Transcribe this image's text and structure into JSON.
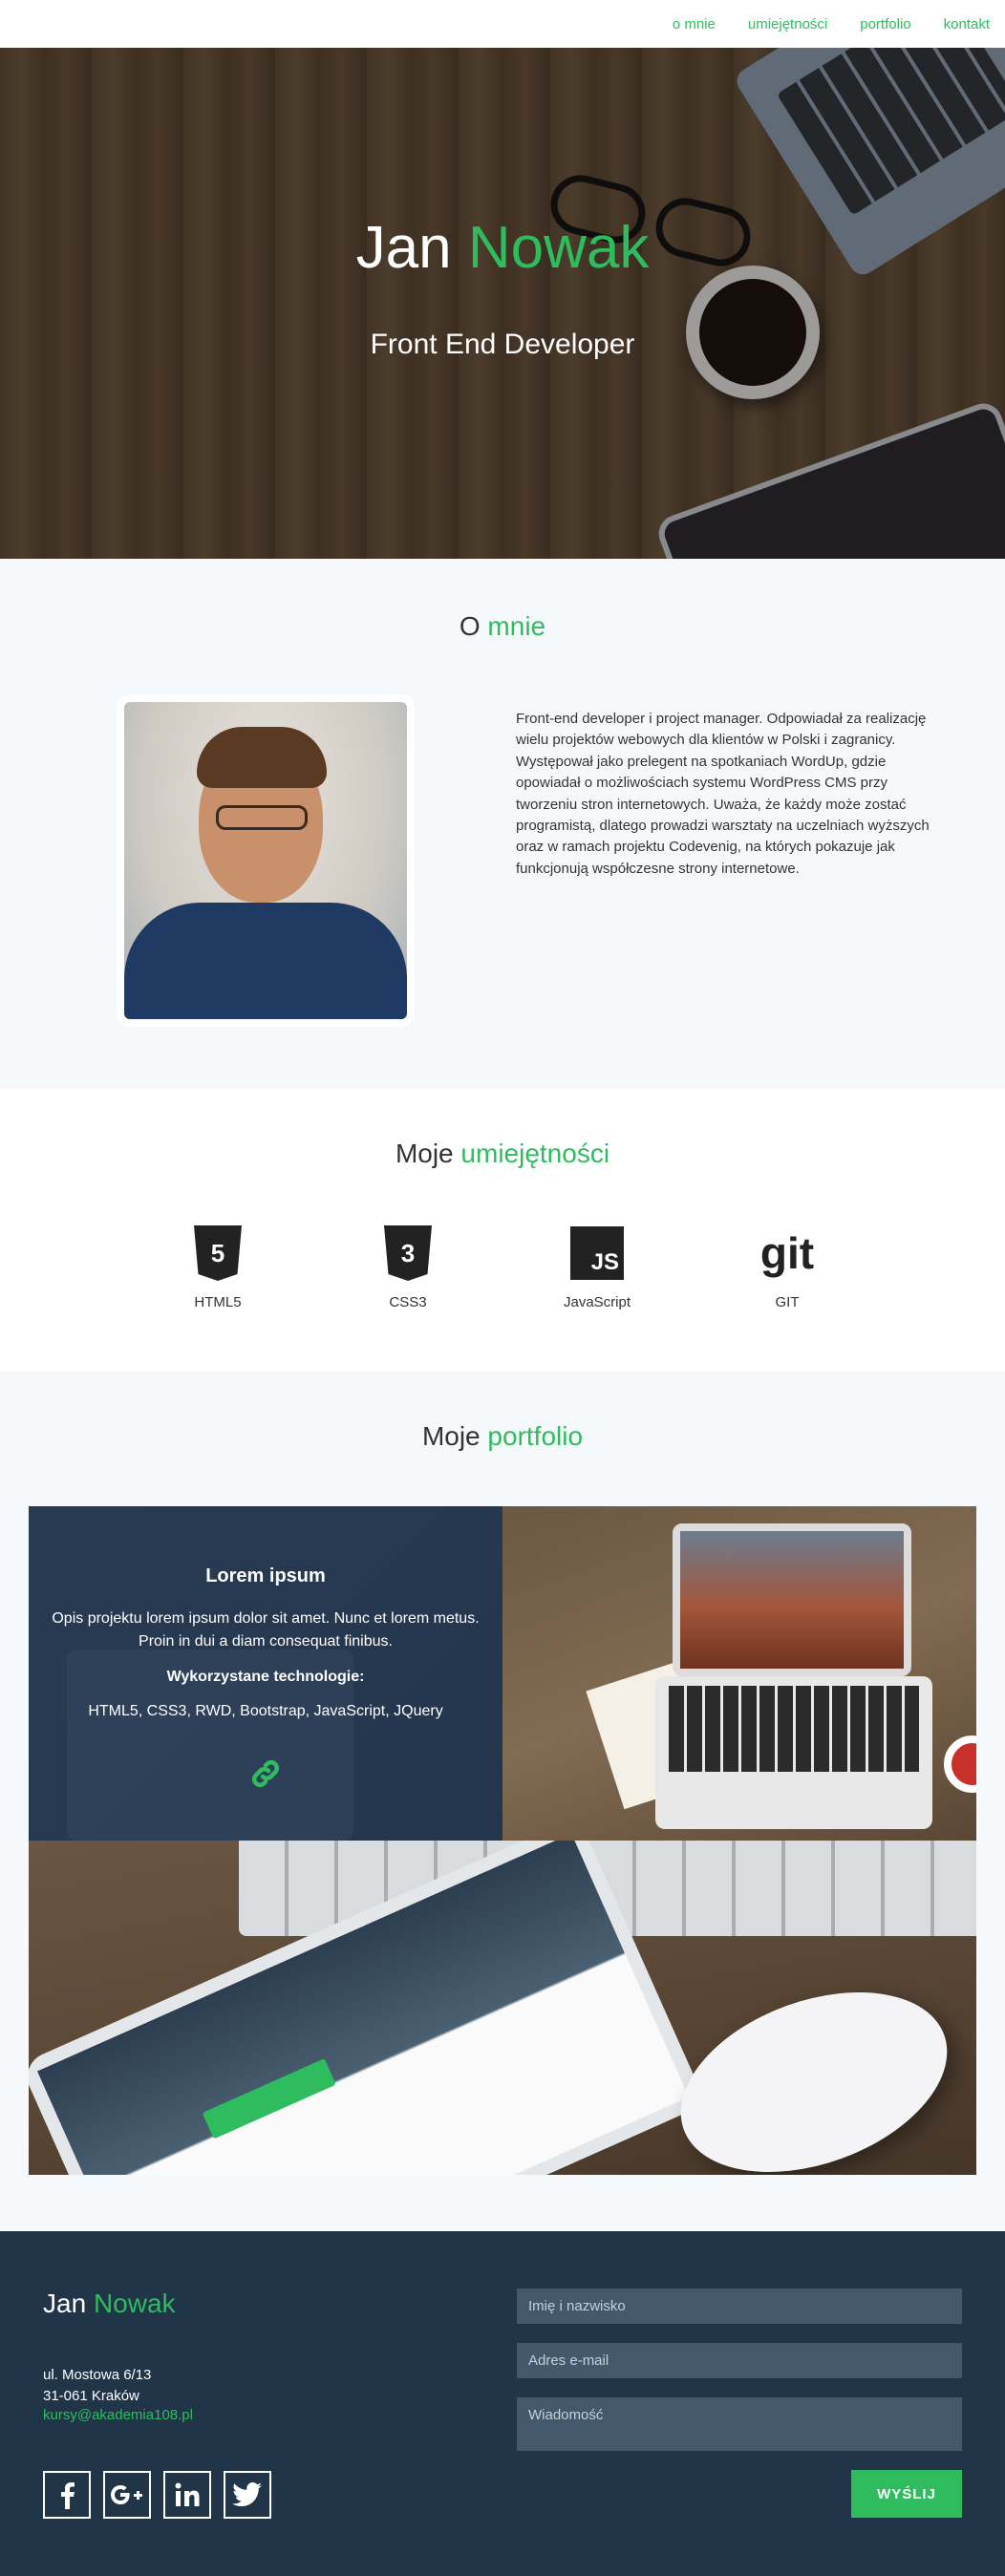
{
  "nav": {
    "items": [
      {
        "label": "o mnie"
      },
      {
        "label": "umiejętności"
      },
      {
        "label": "portfolio"
      },
      {
        "label": "kontakt"
      }
    ]
  },
  "hero": {
    "first_name": "Jan",
    "last_name": "Nowak",
    "subtitle": "Front End Developer"
  },
  "about": {
    "title_a": "O",
    "title_b": "mnie",
    "text": "Front-end developer i project manager. Odpowiadał za realizację wielu projektów webowych dla klientów w Polski i zagranicy. Występował jako prelegent na spotkaniach WordUp, gdzie opowiadał o możliwościach systemu WordPress CMS przy tworzeniu stron internetowych. Uważa, że każdy może zostać programistą, dlatego prowadzi warsztaty na uczelniach wyższych oraz w ramach projektu Codevenig, na których pokazuje jak funkcjonują współczesne strony internetowe."
  },
  "skills": {
    "title_a": "Moje",
    "title_b": "umiejętności",
    "items": [
      {
        "name": "HTML5",
        "icon": "html5-icon",
        "glyph": "5"
      },
      {
        "name": "CSS3",
        "icon": "css3-icon",
        "glyph": "3"
      },
      {
        "name": "JavaScript",
        "icon": "javascript-icon",
        "glyph": "JS"
      },
      {
        "name": "GIT",
        "icon": "git-icon",
        "glyph": "git"
      }
    ]
  },
  "portfolio": {
    "title_a": "Moje",
    "title_b": "portfolio",
    "project": {
      "title": "Lorem ipsum",
      "description": "Opis projektu lorem ipsum dolor sit amet. Nunc et lorem metus. Proin in dui a diam consequat finibus.",
      "tech_label": "Wykorzystane technologie:",
      "tech": "HTML5, CSS3, RWD, Bootstrap, JavaScript, JQuery",
      "link_icon": "link-icon"
    }
  },
  "footer": {
    "brand_first": "Jan",
    "brand_last": "Nowak",
    "address_line1": "ul. Mostowa 6/13",
    "address_line2": "31-061 Kraków",
    "email": "kursy@akademia108.pl",
    "social": [
      "facebook-icon",
      "google-plus-icon",
      "linkedin-icon",
      "twitter-icon"
    ],
    "form": {
      "name_placeholder": "Imię i nazwisko",
      "email_placeholder": "Adres e-mail",
      "message_placeholder": "Wiadomość",
      "send_label": "WYŚLIJ"
    }
  },
  "colors": {
    "accent": "#2ebc5f",
    "footer_bg": "#213549",
    "section_bg": "#f6f9fc"
  }
}
